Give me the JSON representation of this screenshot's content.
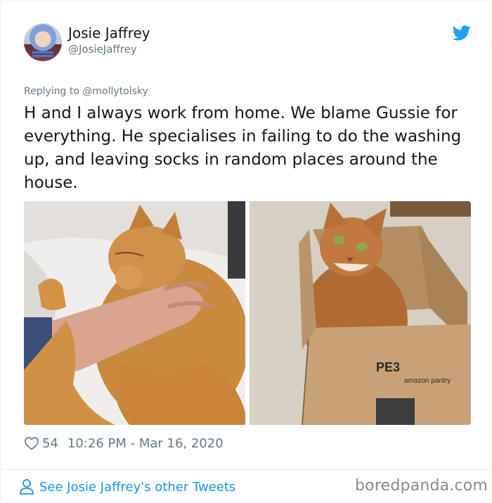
{
  "author": {
    "display_name": "Josie Jaffrey",
    "handle": "@JosieJaffrey",
    "avatar_icon": "user-avatar"
  },
  "brand": {
    "icon": "twitter-bird-icon",
    "accent_color": "#1da1f2"
  },
  "tweet": {
    "replying_to": "Replying to @mollytolsky",
    "text": "H and I always work from home. We blame Gussie for everything. He specialises in failing to do the washing up, and leaving socks in random places around the house.",
    "photos": [
      {
        "name": "photo-cat-on-bed",
        "box_text": ""
      },
      {
        "name": "photo-cat-in-box",
        "box_text": "PE3",
        "box_brand": "amazon pantry"
      }
    ]
  },
  "meta": {
    "like_icon": "heart-icon",
    "like_count": "54",
    "timestamp": "10:26 PM - Mar 16, 2020"
  },
  "footer": {
    "other_tweets_icon": "person-icon",
    "other_tweets_label": "See Josie Jaffrey's other Tweets",
    "watermark": "boredpanda.com"
  }
}
